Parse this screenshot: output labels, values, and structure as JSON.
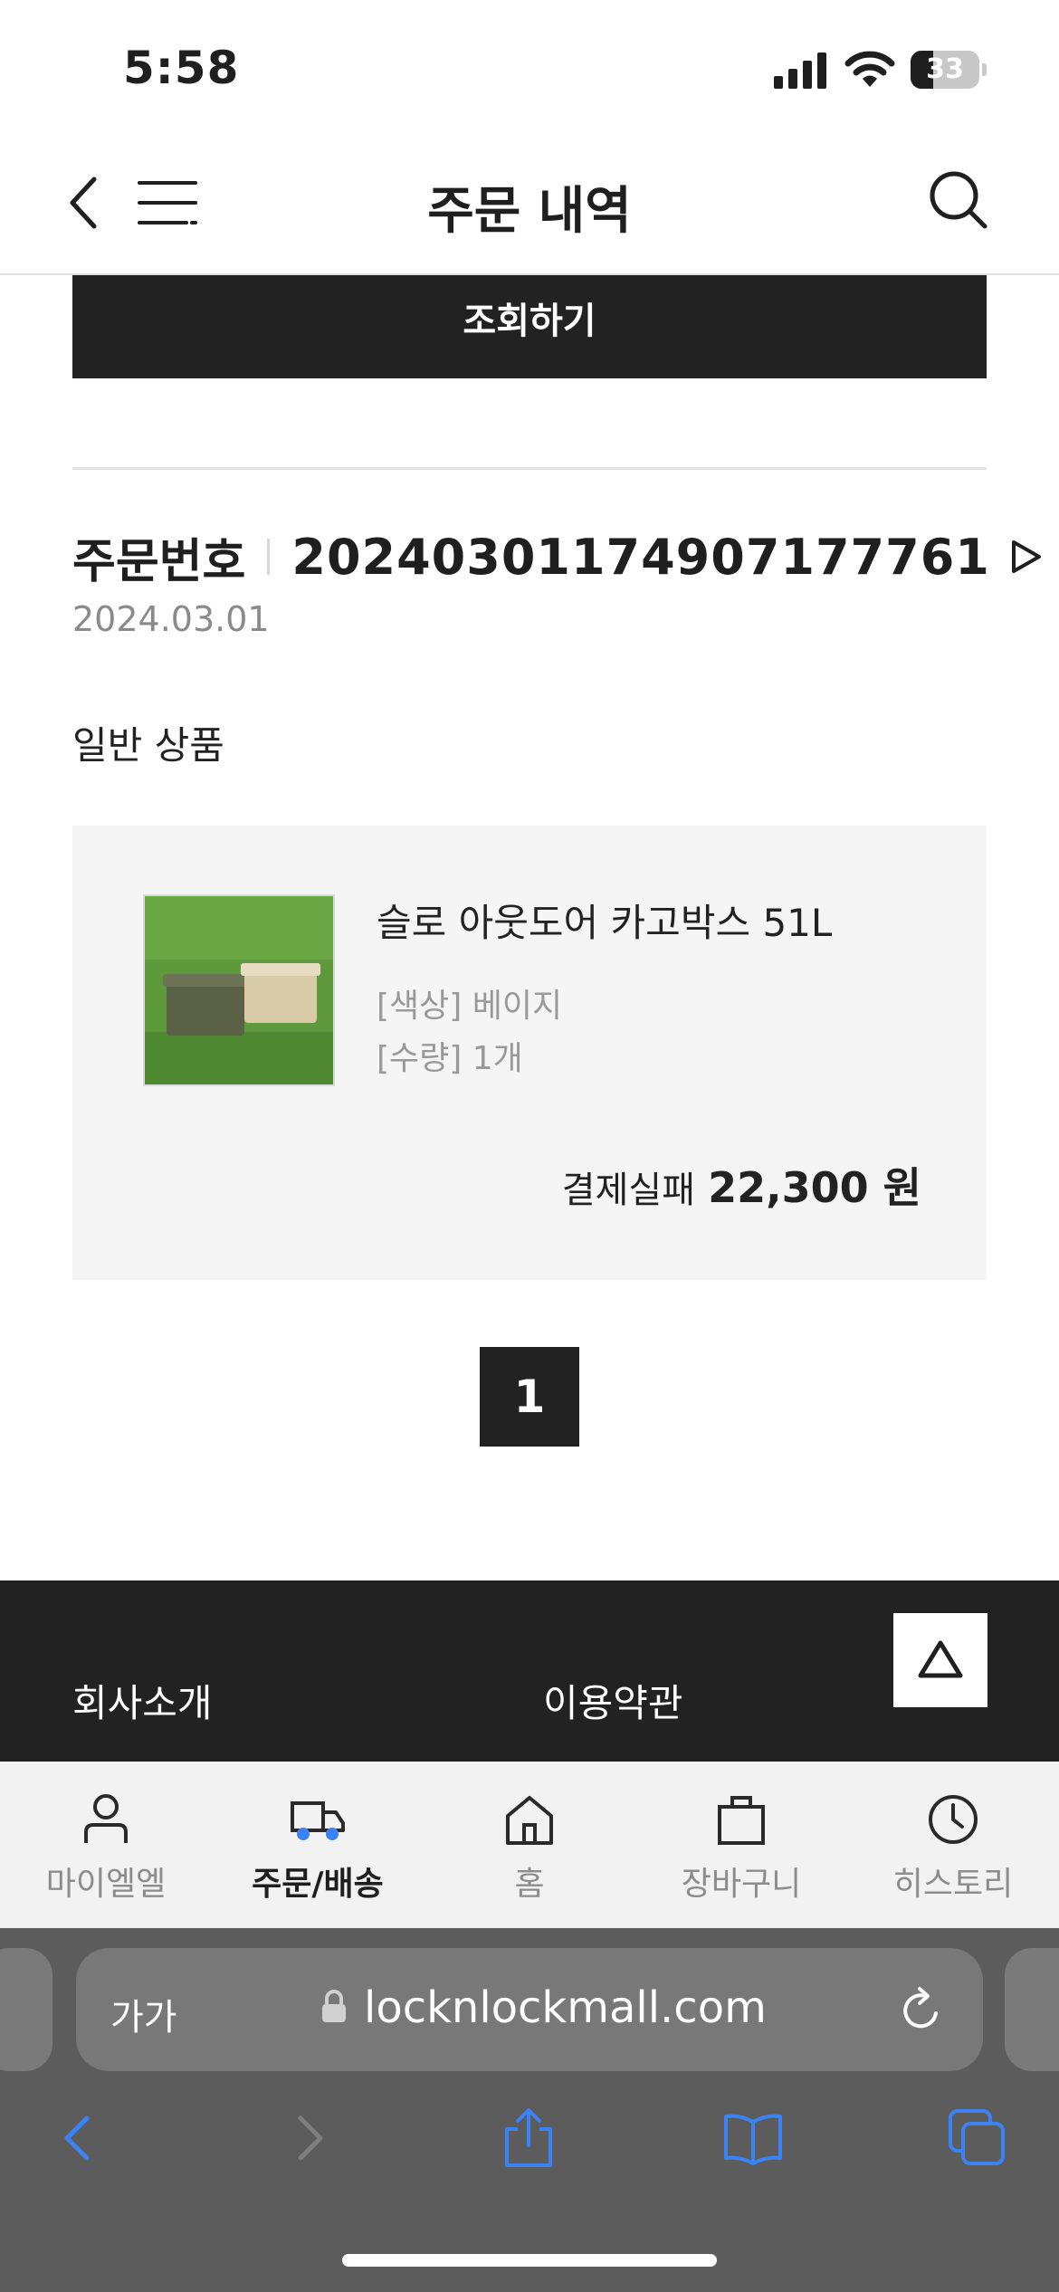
{
  "status_bar": {
    "time": "5:58",
    "battery": "33",
    "battery_level": 0.33
  },
  "header": {
    "title": "주문 내역"
  },
  "lookup_button": {
    "label": "조회하기"
  },
  "order": {
    "label": "주문번호",
    "number": "20240301174907177761",
    "date": "2024.03.01",
    "section": "일반 상품",
    "item": {
      "name": "슬로 아웃도어 카고박스 51L",
      "option_color": "[색상] 베이지",
      "option_qty": "[수량] 1개",
      "status": "결제실패",
      "price": "22,300 원"
    }
  },
  "pagination": {
    "current": "1"
  },
  "footer": {
    "company": "회사소개",
    "terms": "이용약관"
  },
  "tab_bar": {
    "items": [
      {
        "label": "마이엘엘",
        "icon": "person-icon"
      },
      {
        "label": "주문/배송",
        "icon": "delivery-truck-icon",
        "active": true
      },
      {
        "label": "홈",
        "icon": "home-icon"
      },
      {
        "label": "장바구니",
        "icon": "shopping-bag-icon"
      },
      {
        "label": "히스토리",
        "icon": "clock-icon"
      }
    ]
  },
  "browser": {
    "text_size": "가가",
    "url": "locknlockmall.com",
    "accent": "#3b82f6"
  }
}
